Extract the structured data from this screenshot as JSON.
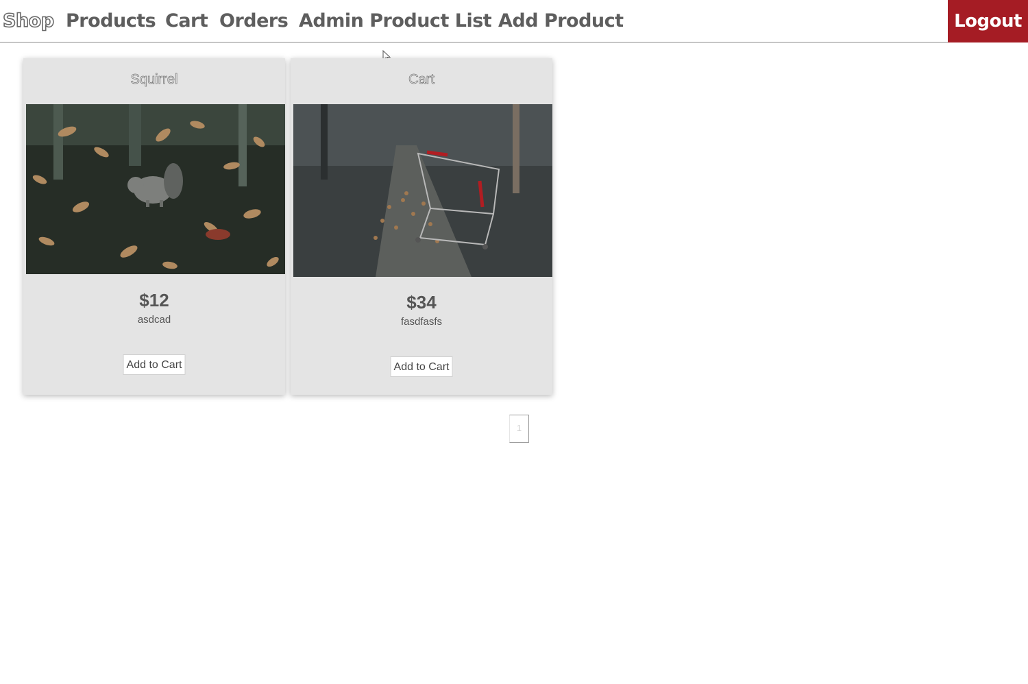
{
  "nav": {
    "items": [
      {
        "label": "Shop",
        "active": true
      },
      {
        "label": "Products",
        "active": false
      },
      {
        "label": "Cart",
        "active": false
      },
      {
        "label": "Orders",
        "active": false
      },
      {
        "label": "Admin Product List",
        "active": false
      },
      {
        "label": "Add Product",
        "active": false
      }
    ],
    "logout_label": "Logout"
  },
  "products": [
    {
      "title": "Squirrel",
      "image": "squirrel-in-autumn-leaves-photo",
      "price": "$12",
      "description": "asdcad",
      "button_label": "Add to Cart"
    },
    {
      "title": "Cart",
      "image": "shopping-cart-on-leafy-path-photo",
      "price": "$34",
      "description": "fasdfasfs",
      "button_label": "Add to Cart"
    }
  ],
  "pagination": {
    "current_page": "1"
  },
  "colors": {
    "logout_bg": "#a51c24",
    "card_bg": "#e4e4e4",
    "nav_text": "#5e5e5e"
  }
}
